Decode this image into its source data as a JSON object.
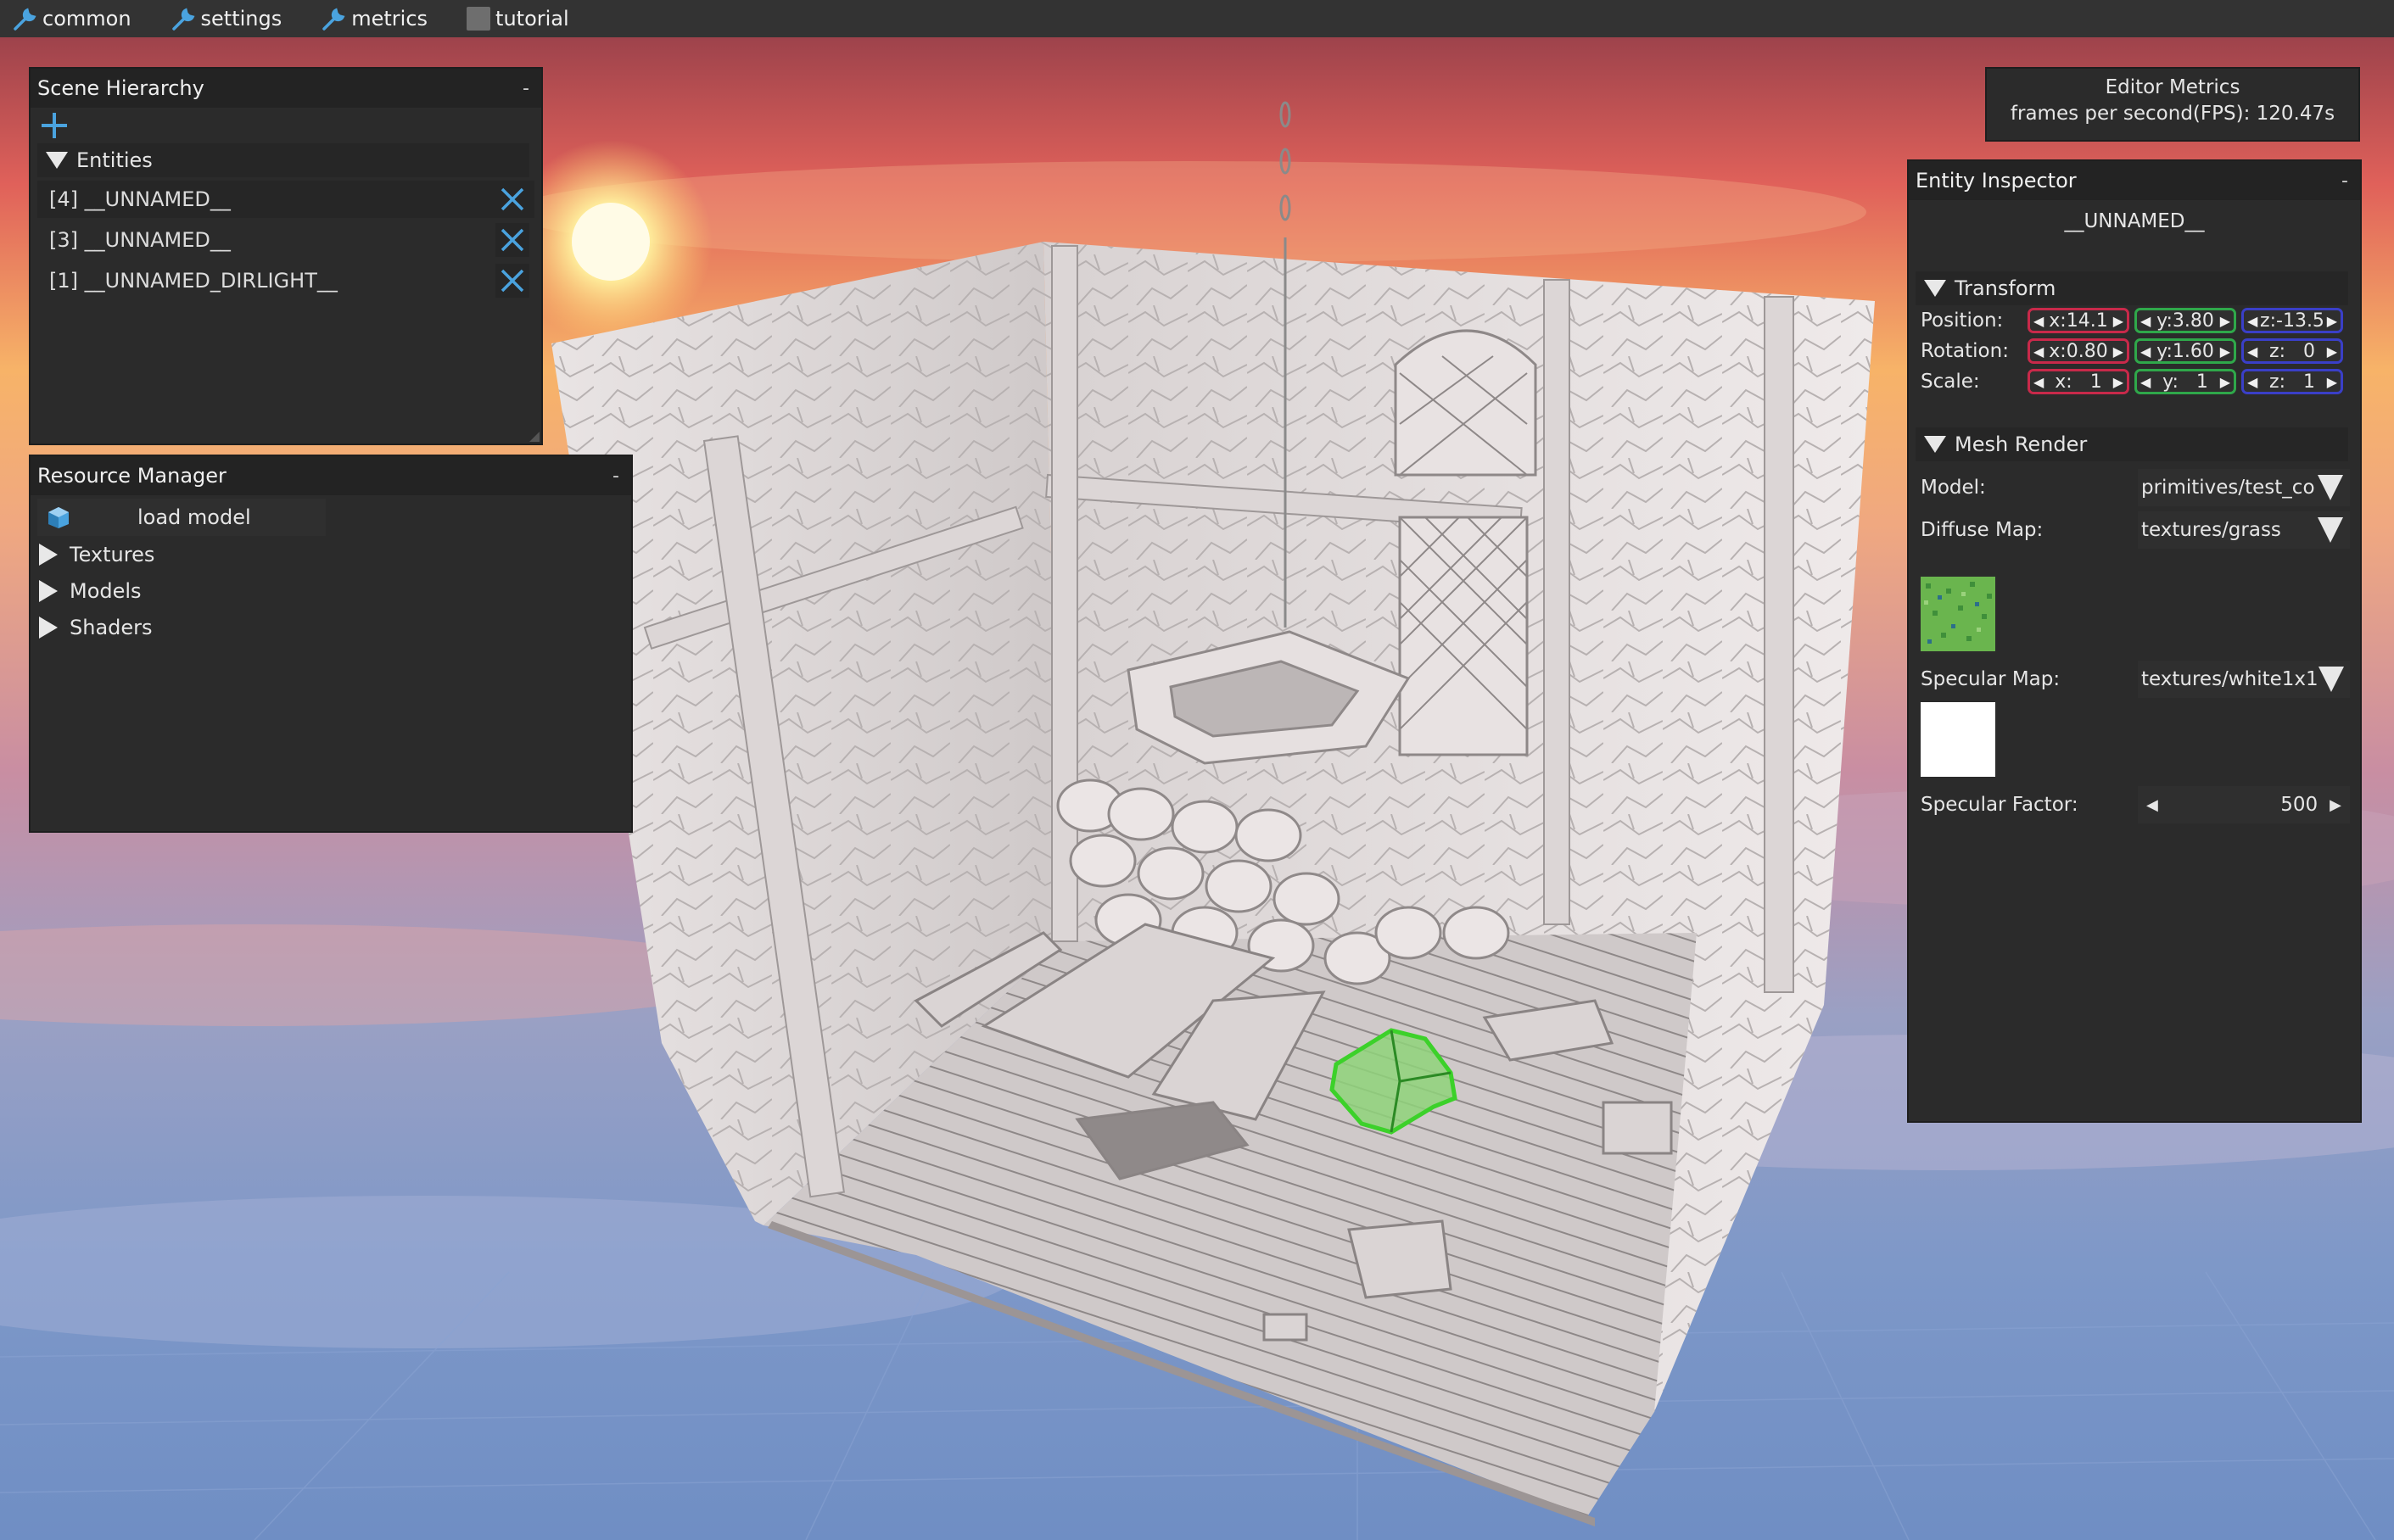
{
  "menu": {
    "items": [
      {
        "label": "common",
        "icon": "wrench-icon"
      },
      {
        "label": "settings",
        "icon": "wrench-icon"
      },
      {
        "label": "metrics",
        "icon": "wrench-icon"
      },
      {
        "label": "tutorial",
        "icon": "checkbox-icon"
      }
    ]
  },
  "scene_hierarchy": {
    "title": "Scene Hierarchy",
    "collapse": "-",
    "entities_header": "Entities",
    "entities": [
      {
        "label": "[4] __UNNAMED__"
      },
      {
        "label": "[3] __UNNAMED__"
      },
      {
        "label": "[1] __UNNAMED_DIRLIGHT__"
      }
    ]
  },
  "resource_manager": {
    "title": "Resource Manager",
    "collapse": "-",
    "load_model": "load model",
    "sections": [
      "Textures",
      "Models",
      "Shaders"
    ]
  },
  "editor_metrics": {
    "title": "Editor Metrics",
    "fps": "frames per second(FPS): 120.47s"
  },
  "inspector": {
    "title": "Entity Inspector",
    "collapse": "-",
    "entity_name": "__UNNAMED__",
    "transform": {
      "header": "Transform",
      "position_label": "Position:",
      "position": {
        "x": "x:14.1",
        "y": "y:3.80",
        "z": "z:-13.5"
      },
      "rotation_label": "Rotation:",
      "rotation": {
        "x": "x:0.80",
        "y": "y:1.60",
        "z": "z:   0"
      },
      "scale_label": "Scale:",
      "scale": {
        "x": "x:   1",
        "y": "y:   1",
        "z": "z:   1"
      }
    },
    "mesh_render": {
      "header": "Mesh Render",
      "model_label": "Model:",
      "model_value": "primitives/test_co",
      "diffuse_label": "Diffuse Map:",
      "diffuse_value": "textures/grass",
      "specular_label": "Specular Map:",
      "specular_value": "textures/white1x1",
      "factor_label": "Specular Factor:",
      "factor_value": "500"
    }
  },
  "colors": {
    "panel_bg": "#2b2b2b",
    "menu_bg": "#333333",
    "accent_blue": "#4aa3df",
    "axis_x": "#c8294a",
    "axis_y": "#2fa84a",
    "axis_z": "#3a3fc7",
    "selection_green": "#5ad43a"
  }
}
